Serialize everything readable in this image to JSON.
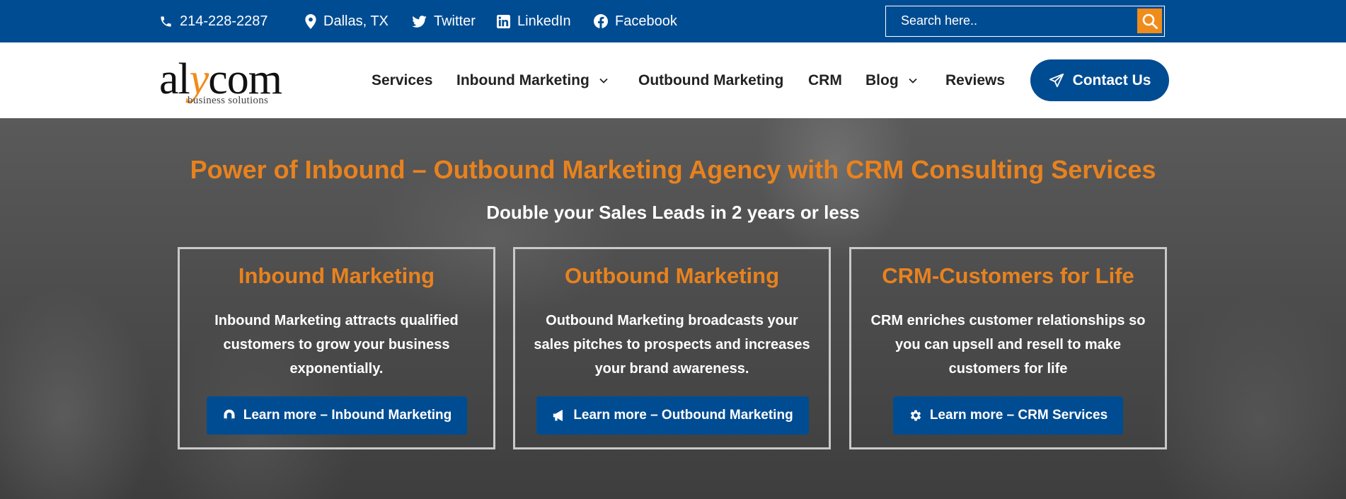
{
  "topbar": {
    "phone": "214-228-2287",
    "location": "Dallas, TX",
    "twitter": "Twitter",
    "linkedin": "LinkedIn",
    "facebook": "Facebook",
    "search_placeholder": "Search here.."
  },
  "header": {
    "logo_prefix": "al",
    "logo_accent": "y",
    "logo_suffix": "com",
    "logo_tagline": "business solutions",
    "nav": {
      "services": "Services",
      "inbound": "Inbound Marketing",
      "outbound": "Outbound Marketing",
      "crm": "CRM",
      "blog": "Blog",
      "reviews": "Reviews"
    },
    "contact_label": "Contact Us"
  },
  "hero": {
    "title": "Power of Inbound – Outbound Marketing Agency with CRM Consulting Services",
    "subtitle": "Double your Sales Leads in 2 years or less",
    "cards": [
      {
        "title": "Inbound Marketing",
        "line1": "Inbound Marketing attracts qualified",
        "line2": "customers to grow your business",
        "line3": "exponentially.",
        "button": "Learn more – Inbound Marketing",
        "icon": "magnet-icon"
      },
      {
        "title": "Outbound Marketing",
        "line1": "Outbound Marketing broadcasts your",
        "line2": "sales pitches to prospects and increases",
        "line3": "your brand awareness.",
        "button": "Learn more – Outbound Marketing",
        "icon": "megaphone-icon"
      },
      {
        "title": "CRM-Customers for Life",
        "line1": "CRM enriches customer relationships so",
        "line2": "you can upsell and resell to make",
        "line3": "customers for life",
        "button": "Learn more – CRM Services",
        "icon": "gear-icon"
      }
    ]
  },
  "colors": {
    "brand_blue": "#004c92",
    "accent_orange": "#e8821e",
    "search_button": "#f08c1c"
  }
}
